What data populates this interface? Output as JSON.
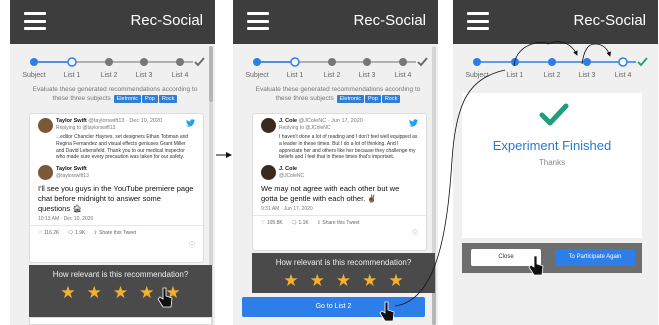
{
  "app_title": "Rec-Social",
  "steps": [
    "Subject",
    "List 1",
    "List 2",
    "List 3",
    "List 4"
  ],
  "instructions_prefix": "Evaluate these generated recommendations according to these three subjects",
  "subjects": [
    "Eletronic",
    "Pop",
    "Rock"
  ],
  "colors": {
    "accent": "#2d7ee8",
    "appbar": "#3d3d3d",
    "star": "#f2b230",
    "check": "#1e9e7a",
    "finished": "#2878d6"
  },
  "panel1": {
    "quoted_name": "Taylor Swift",
    "quoted_handle": "@taylorswift13 · Dec 10, 2020",
    "quoted_reply": "Replying to @taylorswift13",
    "quoted_text": "...editor Chancler Haynes, set designers Ethan Tobman and Regina Fernandez and visual effects geniuses Grant Miller and David Lebensfeld. Thank you to our medical inspector who made sure every precaution was taken for our safety.",
    "main_name": "Taylor Swift",
    "main_handle": "@taylorswift13",
    "main_text": "I'll see you guys in the YouTube premiere page chat before midnight to answer some questions 🏚",
    "timestamp": "10:13 AM · Dec 10, 2020",
    "likes": "116.2K",
    "replies": "1.9K",
    "share": "Share this Tweet",
    "rating_question": "How relevant is this recommendation?",
    "rating": 5
  },
  "panel2": {
    "quoted_name": "J. Cole",
    "quoted_handle": "@JColeNC · Jun 17, 2020",
    "quoted_reply": "Replying to @JColeNC",
    "quoted_text": "I haven't done a lot of reading and I don't feel well equipped as a leader in these times. But I do a lot of thinking. And I appreciate her and others like her because they challenge my beliefs and I feel that in these times that's important.",
    "main_name": "J. Cole",
    "main_handle": "@JColeNC",
    "main_text": "We may not agree with each other but we gotta be gentle with each other. ✌🏾",
    "timestamp": "9:31 AM · Jun 17, 2020",
    "likes": "105.8K",
    "replies": "1.1K",
    "share": "Share this Tweet",
    "rating_question": "How relevant is this recommendation?",
    "rating": 5,
    "next_button": "Go to List 2"
  },
  "panel3": {
    "finished_title": "Experiment Finished",
    "finished_sub": "Thanks",
    "close_button": "Close",
    "participate_button": "To Participate Again"
  }
}
